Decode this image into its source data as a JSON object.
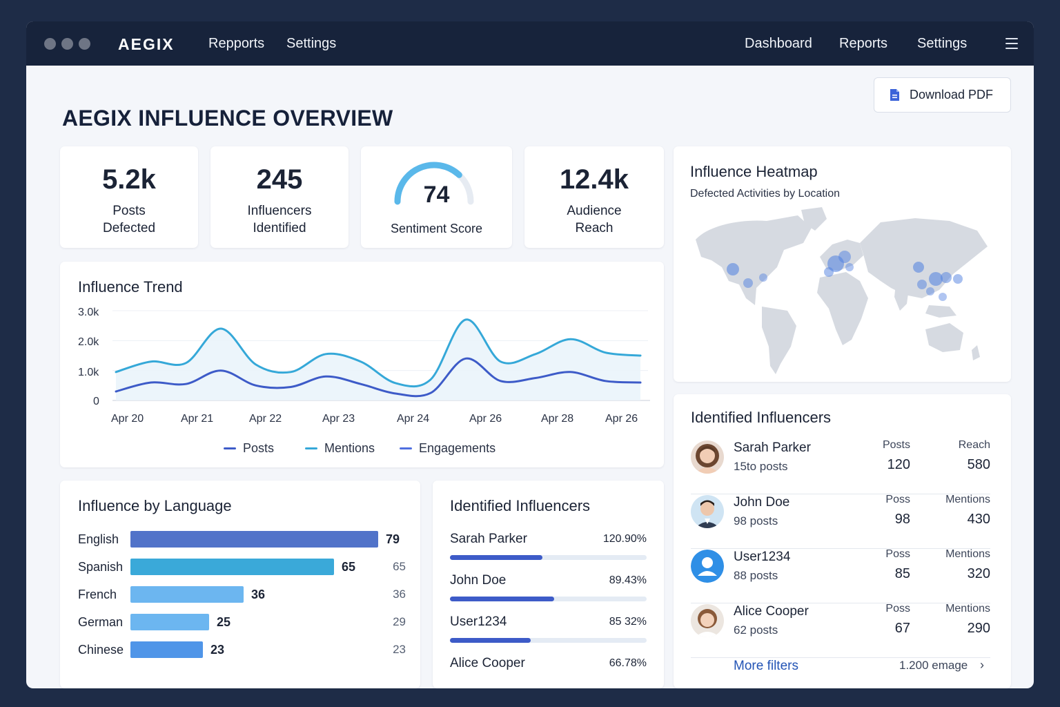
{
  "titlebar": {
    "brand": "AEGIX",
    "left_nav": [
      "Repports",
      "Settings"
    ],
    "right_nav": [
      "Dashboard",
      "Reports",
      "Settings"
    ],
    "menu_icon": "hamburger-icon"
  },
  "page": {
    "title": "AEGIX INFLUENCE OVERVIEW",
    "download_label": "Download PDF",
    "download_icon": "document-icon"
  },
  "stats": [
    {
      "value": "5.2k",
      "label_line1": "Posts",
      "label_line2": "Defected"
    },
    {
      "value": "245",
      "label_line1": "Influencers",
      "label_line2": "Identified"
    },
    {
      "value": "74",
      "label_line1": "Sentiment Score",
      "label_line2": "",
      "gauge_fraction": 0.74
    },
    {
      "value": "12.4k",
      "label_line1": "Audience",
      "label_line2": "Reach"
    }
  ],
  "trend": {
    "title": "Influence Trend",
    "legend": [
      "Posts",
      "Mentions",
      "Engagements"
    ]
  },
  "chart_data": {
    "type": "line",
    "title": "Influence Trend",
    "yticks": [
      "3.0k",
      "2.0k",
      "1.0k",
      "0"
    ],
    "ylim": [
      0,
      3000
    ],
    "categories": [
      "Apr 20",
      "Apr 21",
      "Apr 22",
      "Apr 23",
      "Apr 24",
      "Apr 26",
      "Apr 28",
      "Apr 26"
    ],
    "x": [
      0,
      0.5,
      1,
      1.5,
      2,
      2.5,
      3,
      3.5,
      4,
      4.5,
      5,
      5.5,
      6,
      6.5,
      7,
      7.5
    ],
    "series": [
      {
        "name": "Mentions",
        "color": "#35a8d8",
        "values": [
          950,
          1300,
          1250,
          2400,
          1200,
          950,
          1550,
          1300,
          580,
          700,
          2700,
          1300,
          1550,
          2050,
          1600,
          1500
        ]
      },
      {
        "name": "Engagements",
        "color": "#3d5bc8",
        "values": [
          300,
          600,
          550,
          1000,
          500,
          450,
          800,
          550,
          230,
          250,
          1400,
          650,
          750,
          950,
          650,
          600
        ]
      }
    ],
    "grid": true,
    "legend_placement": "bottom"
  },
  "languages": {
    "title": "Influence by Language",
    "max": 79,
    "items": [
      {
        "name": "English",
        "value": 79,
        "right": "",
        "color": "#5173c9"
      },
      {
        "name": "Spanish",
        "value": 65,
        "right": "65",
        "color": "#3aa9d9"
      },
      {
        "name": "French",
        "value": 36,
        "right": "36",
        "color": "#6cb6f0"
      },
      {
        "name": "German",
        "value": 25,
        "right": "29",
        "color": "#6cb6f0"
      },
      {
        "name": "Chinese",
        "value": 23,
        "right": "23",
        "color": "#4f95e8"
      }
    ]
  },
  "influencers_mid": {
    "title": "Identified Influencers",
    "items": [
      {
        "name": "Sarah Parker",
        "pct": "120.90%",
        "fill": 0.47
      },
      {
        "name": "John Doe",
        "pct": "89.43%",
        "fill": 0.53
      },
      {
        "name": "User1234",
        "pct": "85 32%",
        "fill": 0.41
      },
      {
        "name": "Alice Cooper",
        "pct": "66.78%"
      }
    ]
  },
  "heatmap": {
    "title": "Influence Heatmap",
    "subtitle": "Defected Activities by Location"
  },
  "influencers_right": {
    "title": "Identified Influencers",
    "items": [
      {
        "name": "Sarah Parker",
        "posts": "15to posts",
        "m1_label": "Posts",
        "m1_value": "120",
        "m2_label": "Reach",
        "m2_value": "580",
        "avatar": "avatar-photo-icon"
      },
      {
        "name": "John Doe",
        "posts": "98 posts",
        "m1_label": "Poss",
        "m1_value": "98",
        "m2_label": "Mentions",
        "m2_value": "430",
        "avatar": "avatar-photo-icon"
      },
      {
        "name": "User1234",
        "posts": "88 posts",
        "m1_label": "Poss",
        "m1_value": "85",
        "m2_label": "Mentions",
        "m2_value": "320",
        "avatar": "user-placeholder-icon"
      },
      {
        "name": "Alice Cooper",
        "posts": "62 posts",
        "m1_label": "Poss",
        "m1_value": "67",
        "m2_label": "Mentions",
        "m2_value": "290",
        "avatar": "avatar-photo-icon"
      }
    ],
    "more_label": "More filters",
    "count_label": "1.200 emage",
    "chevron_icon": "chevron-right-icon"
  }
}
